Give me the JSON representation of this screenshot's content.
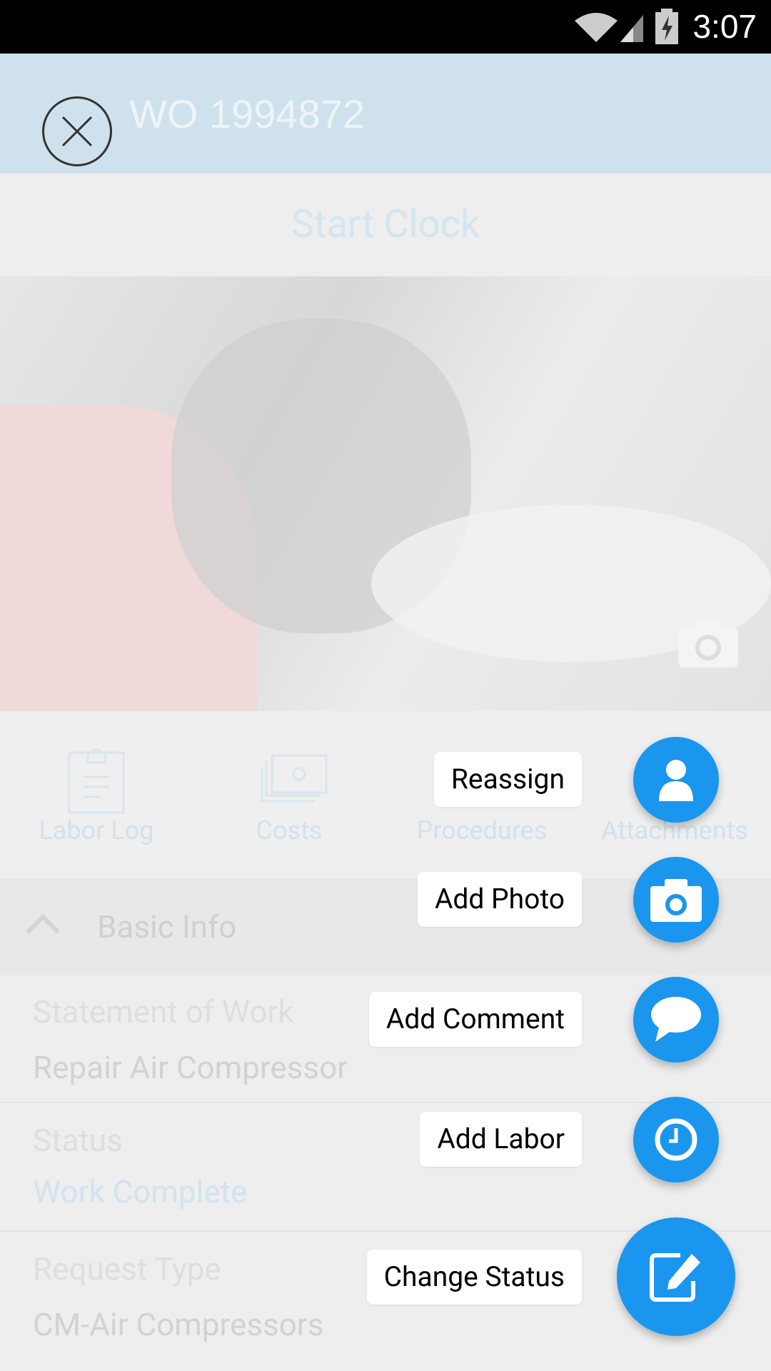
{
  "status_bar": {
    "time": "3:07"
  },
  "header": {
    "title": "WO 1994872"
  },
  "start_clock": "Start Clock",
  "tabs": [
    {
      "label": "Labor Log"
    },
    {
      "label": "Costs"
    },
    {
      "label": "Procedures"
    },
    {
      "label": "Attachments"
    }
  ],
  "basic_info": {
    "title": "Basic Info",
    "fields": [
      {
        "label": "Statement of Work",
        "value": "Repair Air Compressor"
      },
      {
        "label": "Status",
        "value": "Work Complete"
      },
      {
        "label": "Request Type",
        "value": "CM-Air Compressors"
      }
    ]
  },
  "fab_menu": [
    {
      "label": "Reassign",
      "icon": "person-icon"
    },
    {
      "label": "Add Photo",
      "icon": "camera-icon"
    },
    {
      "label": "Add Comment",
      "icon": "comment-icon"
    },
    {
      "label": "Add Labor",
      "icon": "clock-icon"
    },
    {
      "label": "Change Status",
      "icon": "edit-icon"
    }
  ],
  "colors": {
    "accent": "#1a96ef",
    "header": "#cfe1ec"
  }
}
